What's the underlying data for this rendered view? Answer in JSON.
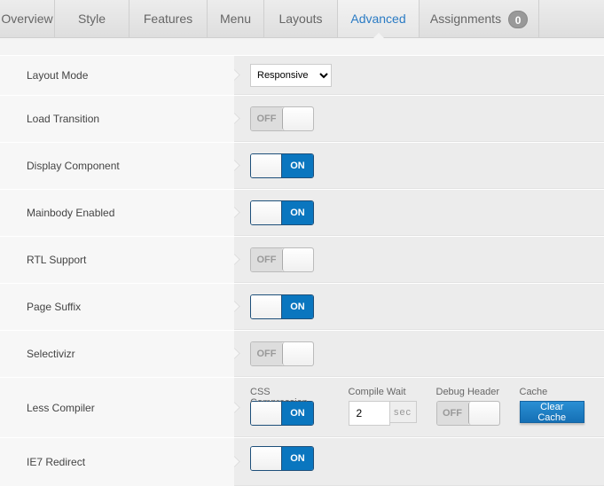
{
  "tabs": [
    {
      "label": "Overview"
    },
    {
      "label": "Style"
    },
    {
      "label": "Features"
    },
    {
      "label": "Menu"
    },
    {
      "label": "Layouts"
    },
    {
      "label": "Advanced",
      "active": true
    },
    {
      "label": "Assignments",
      "badge": "0"
    }
  ],
  "rows": [
    {
      "label": "Layout Mode",
      "select": "Responsive"
    },
    {
      "label": "Load Transition",
      "toggle": "OFF"
    },
    {
      "label": "Display Component",
      "toggle": "ON"
    },
    {
      "label": "Mainbody Enabled",
      "toggle": "ON"
    },
    {
      "label": "RTL Support",
      "toggle": "OFF"
    },
    {
      "label": "Page Suffix",
      "toggle": "ON"
    },
    {
      "label": "Selectivizr",
      "toggle": "OFF"
    },
    {
      "label": "Less Compiler"
    },
    {
      "label": "IE7 Redirect",
      "toggle": "ON"
    }
  ],
  "less": {
    "css_compression_label": "CSS Compression",
    "css_compression": "ON",
    "compile_wait_label": "Compile Wait",
    "compile_wait": "2",
    "compile_wait_unit": "sec",
    "debug_header_label": "Debug Header",
    "debug_header": "OFF",
    "cache_label": "Cache",
    "clear_cache": "Clear Cache"
  },
  "colors": {
    "accent": "#0a76bf",
    "active_tab": "#2a7bc4"
  }
}
